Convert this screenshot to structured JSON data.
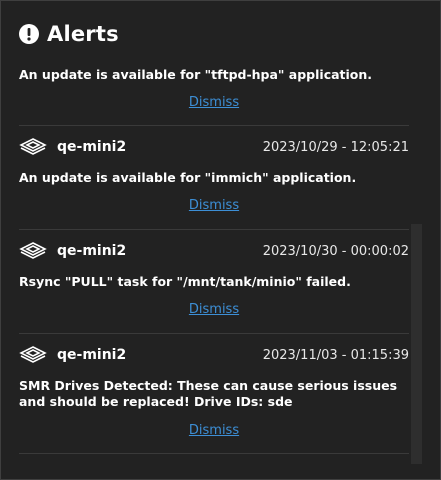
{
  "header": {
    "title": "Alerts",
    "icon": "alert-circle-icon"
  },
  "alerts": [
    {
      "host": "",
      "datetime": "",
      "message": "An update is available for \"tftpd-hpa\" application.",
      "action": "Dismiss"
    },
    {
      "host": "qe-mini2",
      "datetime": "2023/10/29 - 12:05:21",
      "message": "An update is available for \"immich\" application.",
      "action": "Dismiss"
    },
    {
      "host": "qe-mini2",
      "datetime": "2023/10/30 - 00:00:02",
      "message": "Rsync \"PULL\" task for \"/mnt/tank/minio\" failed.",
      "action": "Dismiss"
    },
    {
      "host": "qe-mini2",
      "datetime": "2023/11/03 - 01:15:39",
      "message": "SMR Drives Detected: These can cause serious issues and should be replaced! Drive IDs: sde",
      "action": "Dismiss"
    }
  ],
  "colors": {
    "background": "#222222",
    "text": "#ffffff",
    "link": "#3d8fd6",
    "divider": "#3a3a3a"
  }
}
